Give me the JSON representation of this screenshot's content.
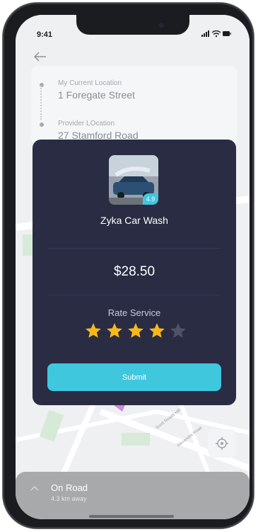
{
  "status_bar": {
    "time": "9:41",
    "icons": [
      "signal-icon",
      "wifi-icon",
      "battery-icon"
    ]
  },
  "nav": {
    "back_icon": "arrow-left-icon"
  },
  "route": {
    "current": {
      "label": "My Current Location",
      "value": "1 Foregate Street"
    },
    "provider": {
      "label": "Provider LOcation",
      "value": "27 Stamford Road"
    }
  },
  "rating_modal": {
    "provider_name": "Zyka Car Wash",
    "provider_rating": "4.9",
    "price": "$28.50",
    "rate_label": "Rate Service",
    "stars_filled": 4,
    "stars_total": 5,
    "submit_label": "Submit"
  },
  "bottom_sheet": {
    "title": "On Road",
    "subtitle": "4.3 km away",
    "chevron_icon": "chevron-up-icon"
  },
  "map": {
    "locate_icon": "locate-icon"
  },
  "colors": {
    "accent": "#3fc7dd",
    "modal_bg": "#2a2c44",
    "star": "#f6b81b",
    "star_empty": "#505266"
  }
}
